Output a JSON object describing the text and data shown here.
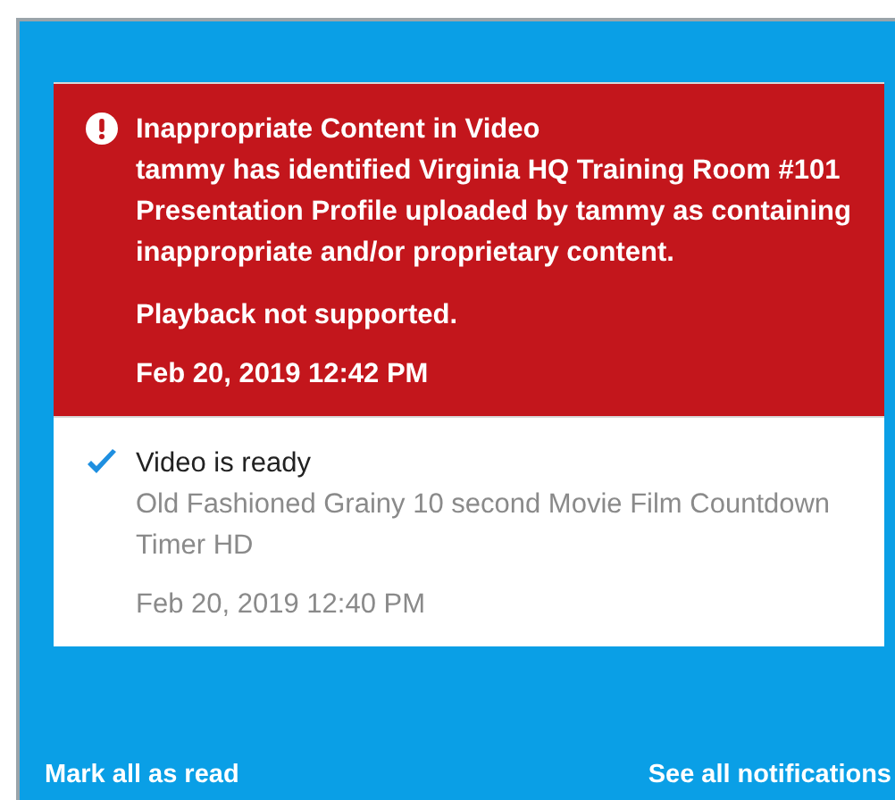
{
  "notifications": [
    {
      "kind": "alert",
      "title": "Inappropriate Content in Video",
      "body": "tammy has identified Virginia HQ Training Room #101 Presentation Profile uploaded by tammy as containing inappropriate and/or proprietary content.",
      "note": "Playback not supported.",
      "time": "Feb 20, 2019 12:42 PM"
    },
    {
      "kind": "ready",
      "title": "Video is ready",
      "body": "Old Fashioned Grainy 10 second Movie Film Countdown Timer HD",
      "time": "Feb 20, 2019 12:40 PM"
    }
  ],
  "footer": {
    "mark_all": "Mark all as read",
    "see_all": "See all notifications"
  }
}
